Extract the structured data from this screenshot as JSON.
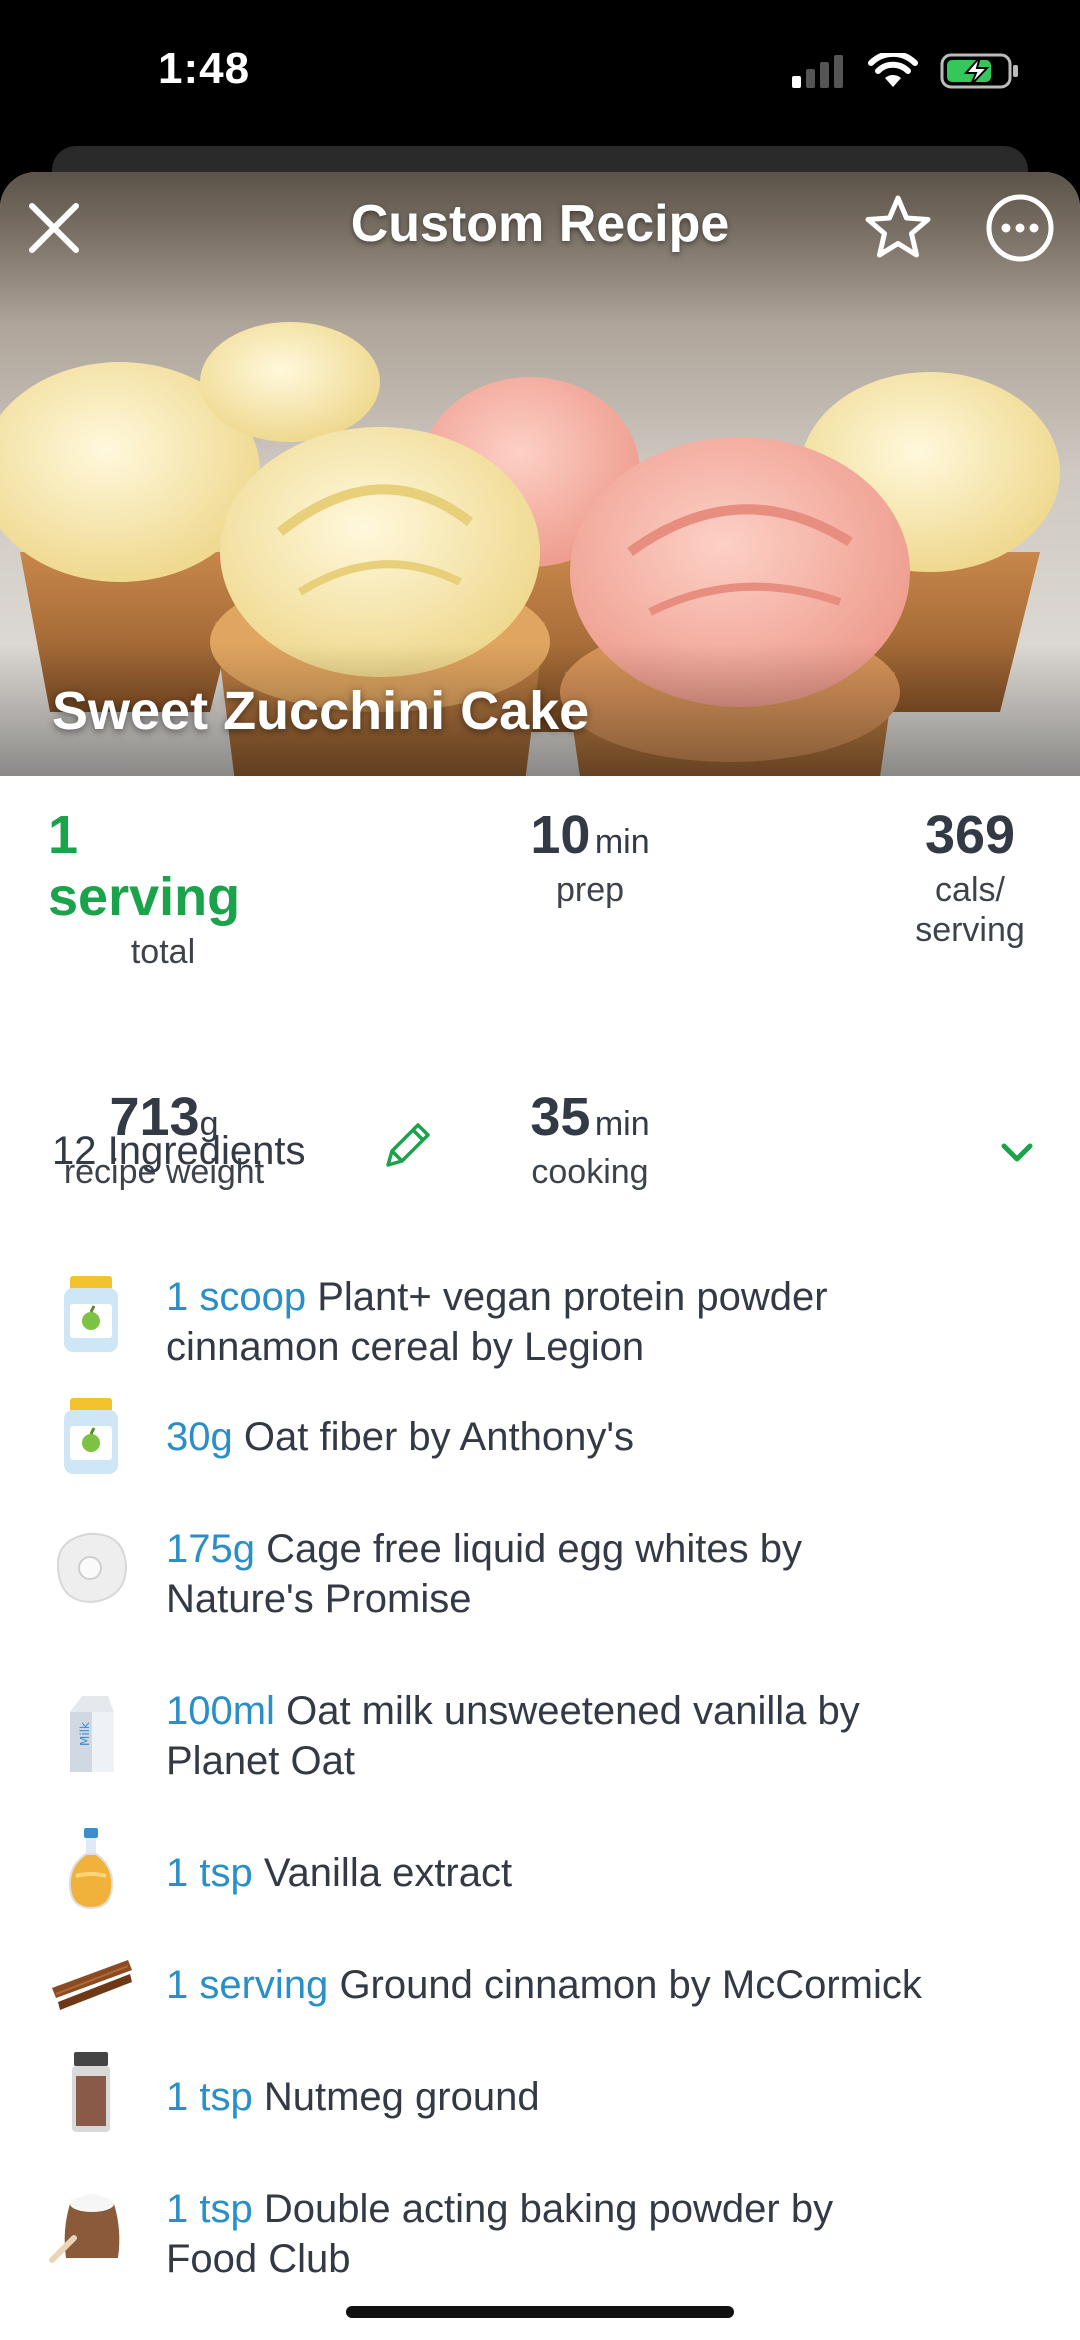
{
  "status_bar": {
    "time": "1:48"
  },
  "header": {
    "title": "Custom Recipe"
  },
  "recipe": {
    "name": "Sweet Zucchini Cake",
    "servings_value": "1 serving",
    "servings_label": "total",
    "prep_value": "10",
    "prep_unit": "min",
    "prep_label": "prep",
    "cals_value": "369",
    "cals_label_1": "cals/",
    "cals_label_2": "serving",
    "weight_value": "713",
    "weight_unit": "g",
    "weight_label": "recipe weight",
    "cook_value": "35",
    "cook_unit": "min",
    "cook_label": "cooking"
  },
  "ingredients": {
    "title": "12 Ingredients",
    "items": [
      {
        "qty": "1 scoop",
        "name": "Plant+ vegan protein powder",
        "name2": "cinnamon cereal by Legion",
        "icon": "supplement-jar-icon"
      },
      {
        "qty": "30g",
        "name": "Oat fiber by Anthony's",
        "name2": "",
        "icon": "supplement-jar-icon"
      },
      {
        "qty": "175g",
        "name": "Cage free liquid egg whites by",
        "name2": "Nature's Promise",
        "icon": "egg-icon"
      },
      {
        "qty": "100ml",
        "name": "Oat milk unsweetened vanilla by",
        "name2": "Planet Oat",
        "icon": "milk-carton-icon",
        "carton_text": "Milk"
      },
      {
        "qty": "1 tsp",
        "name": "Vanilla extract",
        "name2": "",
        "icon": "oil-bottle-icon"
      },
      {
        "qty": "1 serving",
        "name": "Ground cinnamon by McCormick",
        "name2": "",
        "icon": "cinnamon-stick-icon"
      },
      {
        "qty": "1 tsp",
        "name": "Nutmeg ground",
        "name2": "",
        "icon": "spice-jar-icon"
      },
      {
        "qty": "1 tsp",
        "name": "Double acting baking powder by",
        "name2": "Food Club",
        "icon": "flour-sack-icon"
      }
    ]
  },
  "colors": {
    "accent_green": "#1aa34a",
    "quantity_blue": "#2a8ec7"
  }
}
